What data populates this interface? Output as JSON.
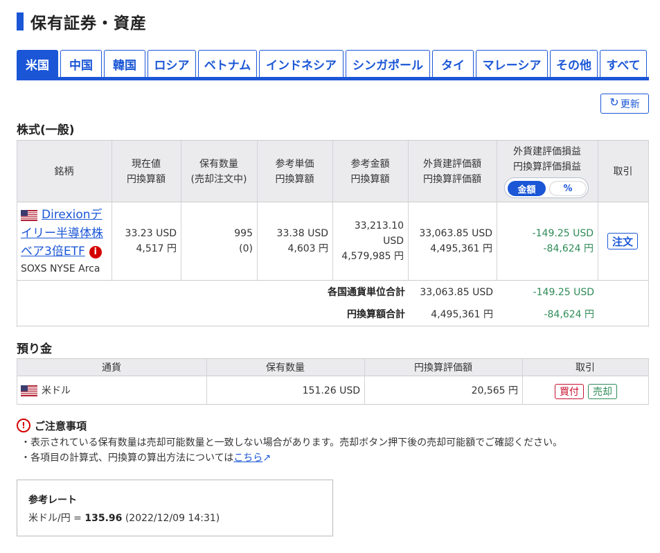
{
  "page": {
    "title": "保有証券・資産"
  },
  "tabs": [
    {
      "label": "米国",
      "active": true
    },
    {
      "label": "中国"
    },
    {
      "label": "韓国"
    },
    {
      "label": "ロシア"
    },
    {
      "label": "ベトナム"
    },
    {
      "label": "インドネシア"
    },
    {
      "label": "シンガポール"
    },
    {
      "label": "タイ"
    },
    {
      "label": "マレーシア"
    },
    {
      "label": "その他"
    },
    {
      "label": "すべて"
    }
  ],
  "refresh_label": "更新",
  "stocks": {
    "section_title": "株式(一般)",
    "headers": {
      "name": "銘柄",
      "price": [
        "現在値",
        "円換算額"
      ],
      "qty": [
        "保有数量",
        "(売却注文中)"
      ],
      "cost": [
        "参考単価",
        "円換算額"
      ],
      "amount": [
        "参考金額",
        "円換算額"
      ],
      "valuation": [
        "外貨建評価額",
        "円換算評価額"
      ],
      "pl": [
        "外貨建評価損益",
        "円換算評価損益"
      ],
      "trade": "取引"
    },
    "toggle": {
      "amount": "金額",
      "percent": "%"
    },
    "row": {
      "name": "Direxionデイリー半導体株ベア3倍ETF",
      "name_lines": [
        "Direxionデ",
        "イリー半導体株",
        "ベア3倍ETF"
      ],
      "ticker": "SOXS",
      "market": "NYSE Arca",
      "price_usd": "33.23 USD",
      "price_jpy": "4,517 円",
      "qty": "995",
      "qty_selling": "(0)",
      "cost_usd": "33.38 USD",
      "cost_jpy": "4,603 円",
      "amount_usd_1": "33,213.10",
      "amount_usd_2": "USD",
      "amount_jpy": "4,579,985 円",
      "val_usd": "33,063.85 USD",
      "val_jpy": "4,495,361 円",
      "pl_usd": "-149.25 USD",
      "pl_jpy": "-84,624 円",
      "order_label": "注文"
    },
    "totals": {
      "currency_label": "各国通貨単位合計",
      "currency_val": "33,063.85 USD",
      "currency_pl": "-149.25 USD",
      "jpy_label": "円換算額合計",
      "jpy_val": "4,495,361 円",
      "jpy_pl": "-84,624 円"
    }
  },
  "deposit": {
    "section_title": "預り金",
    "headers": {
      "currency": "通貨",
      "qty": "保有数量",
      "jpy": "円換算評価額",
      "trade": "取引"
    },
    "row": {
      "currency": "米ドル",
      "qty": "151.26 USD",
      "jpy": "20,565 円",
      "buy": "買付",
      "sell": "売却"
    }
  },
  "notice": {
    "title": "ご注意事項",
    "line1": "・表示されている保有数量は売却可能数量と一致しない場合があります。売却ボタン押下後の売却可能額でご確認ください。",
    "line2_prefix": "・各項目の計算式、円換算の算出方法については",
    "line2_link": "こちら"
  },
  "rate": {
    "title": "参考レート",
    "pair": "米ドル/円 =",
    "value": "135.96",
    "datetime": "(2022/12/09 14:31)"
  },
  "colors": {
    "accent": "#1a56d6",
    "profit_loss": "#2e8b57",
    "buy": "#c8102e",
    "sell": "#2e8b57"
  }
}
